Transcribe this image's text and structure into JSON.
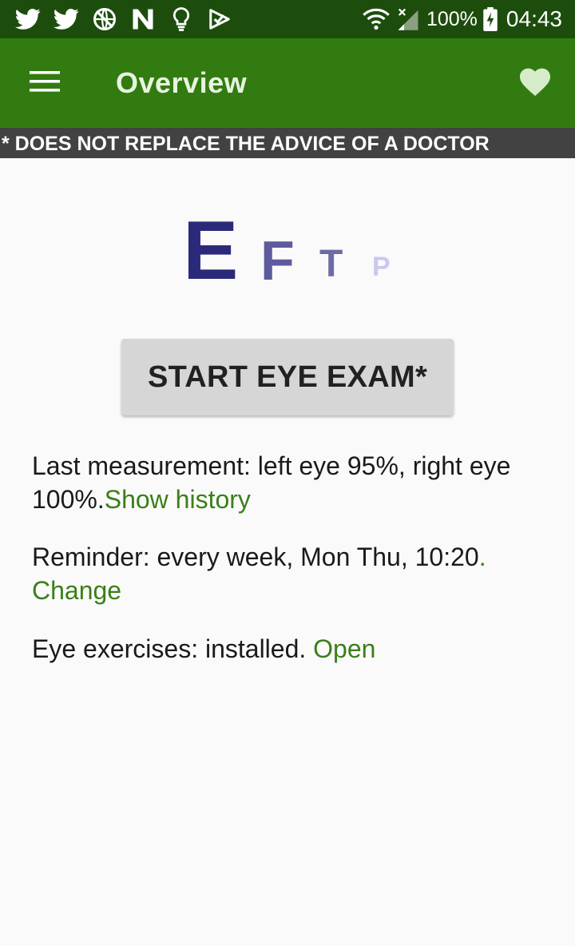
{
  "status_bar": {
    "icons_left": [
      "twitter-icon",
      "twitter-icon",
      "no-globe-icon",
      "n-app-icon",
      "lightbulb-icon",
      "check-badge-icon"
    ],
    "battery_percent": "100%",
    "time": "04:43"
  },
  "app_bar": {
    "title": "Overview",
    "menu_icon": "hamburger-menu-icon",
    "favorite_icon": "heart-icon"
  },
  "disclaimer": "* DOES NOT REPLACE THE ADVICE OF A DOCTOR",
  "eye_chart": {
    "letters": [
      "E",
      "F",
      "T",
      "P"
    ]
  },
  "exam_button": {
    "label": "START EYE EXAM*"
  },
  "last_measurement": {
    "text": "Last measurement: left eye 95%, right eye 100%.",
    "link": "Show history"
  },
  "reminder": {
    "text": "Reminder: every week, Mon Thu, 10:20",
    "link_dot": ".",
    "link": "Change"
  },
  "exercises": {
    "text": "Eye exercises: installed. ",
    "link": "Open"
  },
  "colors": {
    "status_bar": "#1d4d0d",
    "app_bar": "#327b11",
    "disclaimer_bg": "#424242",
    "link": "#3a7f19",
    "button_bg": "#d6d6d6"
  }
}
